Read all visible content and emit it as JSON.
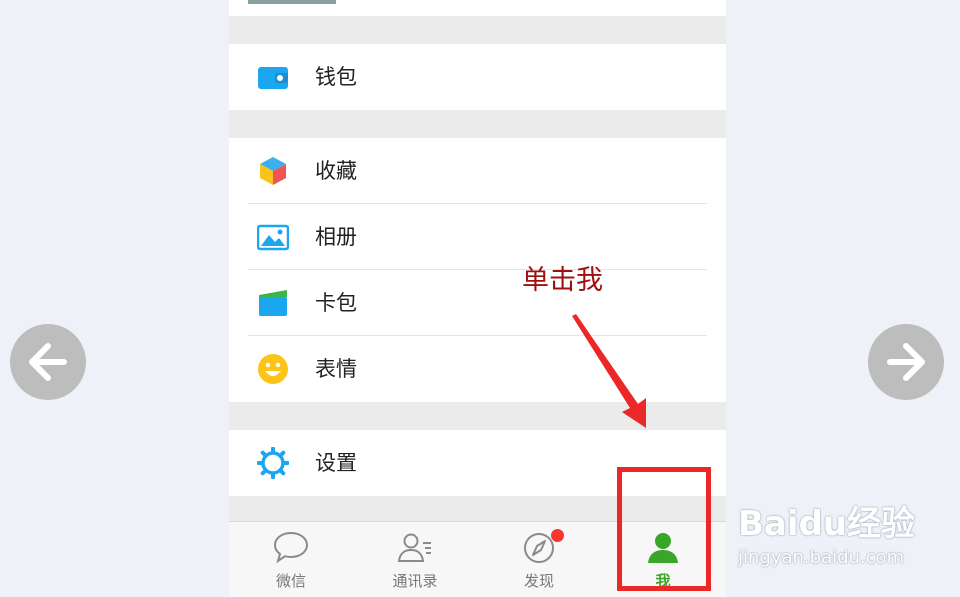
{
  "menu": {
    "wallet": {
      "label": "钱包",
      "icon": "wallet-icon"
    },
    "favorites": {
      "label": "收藏",
      "icon": "cube-icon"
    },
    "album": {
      "label": "相册",
      "icon": "photo-icon"
    },
    "cards": {
      "label": "卡包",
      "icon": "card-icon"
    },
    "stickers": {
      "label": "表情",
      "icon": "smiley-icon"
    },
    "settings": {
      "label": "设置",
      "icon": "gear-icon"
    }
  },
  "tabbar": {
    "tabs": [
      {
        "label": "微信",
        "icon": "chat-bubble-icon",
        "active": false
      },
      {
        "label": "通讯录",
        "icon": "contacts-icon",
        "active": false
      },
      {
        "label": "发现",
        "icon": "compass-icon",
        "active": false,
        "badge": true
      },
      {
        "label": "我",
        "icon": "person-icon",
        "active": true
      }
    ]
  },
  "annotation": {
    "text": "单击我",
    "color": "#a01010",
    "box_color": "#ec2727"
  },
  "watermark": {
    "brand": "Baidu经验",
    "url": "jingyan.baidu.com"
  },
  "colors": {
    "active_tab": "#3aa629",
    "icon_blue": "#1ba7f0",
    "badge": "#f43530"
  }
}
